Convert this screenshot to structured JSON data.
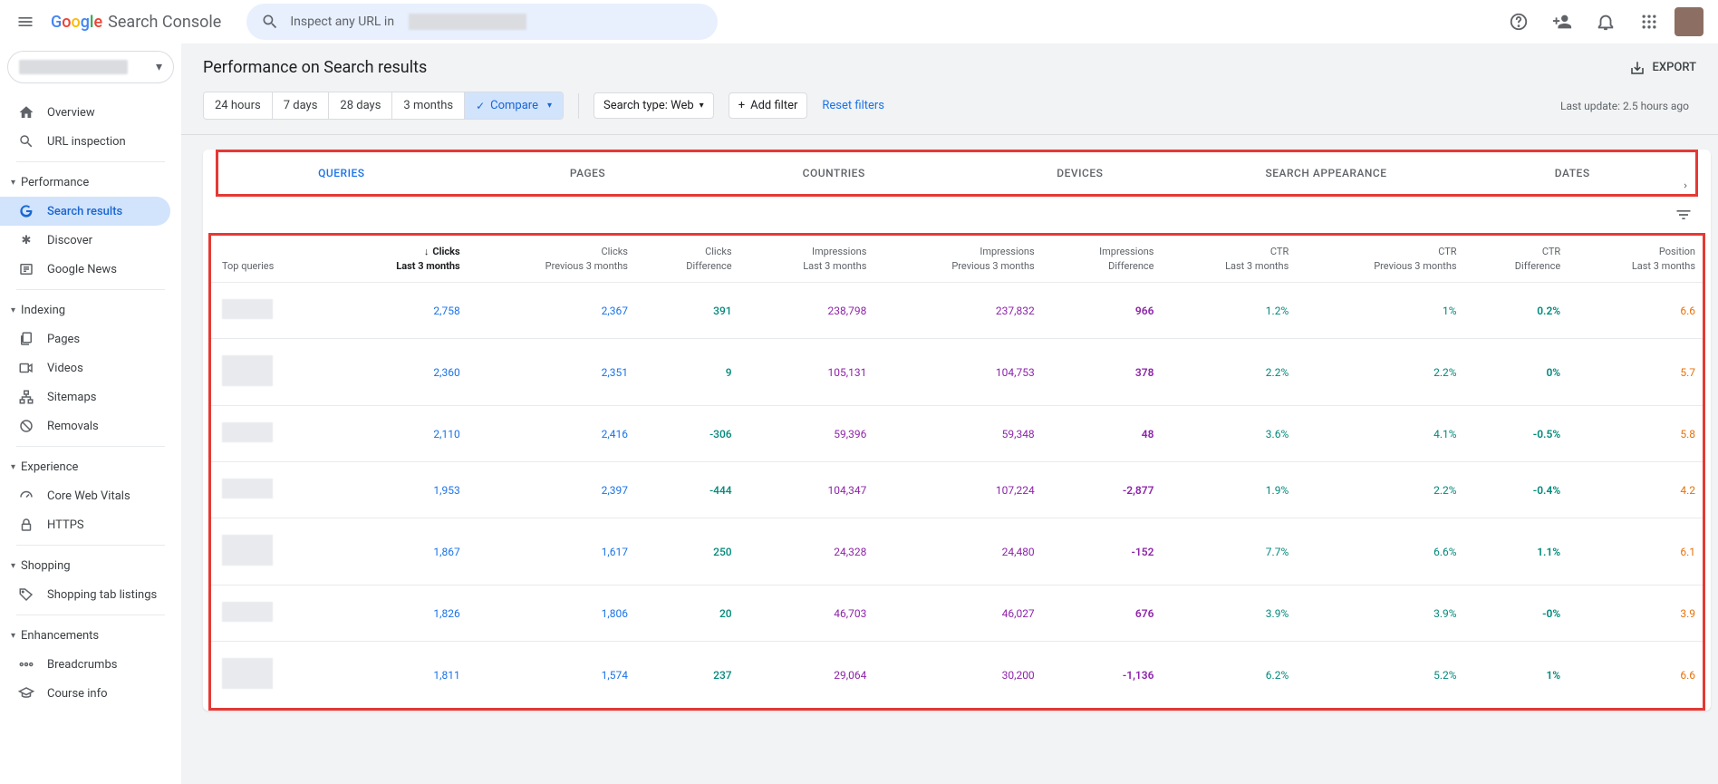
{
  "app": {
    "brand": "Google",
    "product": "Search Console",
    "search_placeholder": "Inspect any URL in"
  },
  "sidebar": {
    "overview": "Overview",
    "url_inspection": "URL inspection",
    "performance": "Performance",
    "search_results": "Search results",
    "discover": "Discover",
    "google_news": "Google News",
    "indexing": "Indexing",
    "pages": "Pages",
    "videos": "Videos",
    "sitemaps": "Sitemaps",
    "removals": "Removals",
    "experience": "Experience",
    "core_web_vitals": "Core Web Vitals",
    "https": "HTTPS",
    "shopping": "Shopping",
    "shopping_tab": "Shopping tab listings",
    "enhancements": "Enhancements",
    "breadcrumbs_item": "Breadcrumbs",
    "course_info": "Course info"
  },
  "page": {
    "title": "Performance on Search results",
    "export": "EXPORT",
    "date_ranges": [
      "24 hours",
      "7 days",
      "28 days",
      "3 months",
      "Compare"
    ],
    "search_type": "Search type: Web",
    "add_filter": "Add filter",
    "reset": "Reset filters",
    "last_update": "Last update: 2.5 hours ago"
  },
  "tabs": [
    "QUERIES",
    "PAGES",
    "COUNTRIES",
    "DEVICES",
    "SEARCH APPEARANCE",
    "DATES"
  ],
  "table": {
    "headers": {
      "query": "Top queries",
      "clicks_last": "Clicks\nLast 3 months",
      "clicks_prev": "Clicks\nPrevious 3 months",
      "clicks_diff": "Clicks\nDifference",
      "imp_last": "Impressions\nLast 3 months",
      "imp_prev": "Impressions\nPrevious 3 months",
      "imp_diff": "Impressions\nDifference",
      "ctr_last": "CTR\nLast 3 months",
      "ctr_prev": "CTR\nPrevious 3 months",
      "ctr_diff": "CTR\nDifference",
      "pos_last": "Position\nLast 3 months"
    },
    "rows": [
      {
        "clicks_last": "2,758",
        "clicks_prev": "2,367",
        "clicks_diff": "391",
        "imp_last": "238,798",
        "imp_prev": "237,832",
        "imp_diff": "966",
        "ctr_last": "1.2%",
        "ctr_prev": "1%",
        "ctr_diff": "0.2%",
        "pos_last": "6.6",
        "tall": false
      },
      {
        "clicks_last": "2,360",
        "clicks_prev": "2,351",
        "clicks_diff": "9",
        "imp_last": "105,131",
        "imp_prev": "104,753",
        "imp_diff": "378",
        "ctr_last": "2.2%",
        "ctr_prev": "2.2%",
        "ctr_diff": "0%",
        "pos_last": "5.7",
        "tall": true
      },
      {
        "clicks_last": "2,110",
        "clicks_prev": "2,416",
        "clicks_diff": "-306",
        "imp_last": "59,396",
        "imp_prev": "59,348",
        "imp_diff": "48",
        "ctr_last": "3.6%",
        "ctr_prev": "4.1%",
        "ctr_diff": "-0.5%",
        "pos_last": "5.8",
        "tall": false
      },
      {
        "clicks_last": "1,953",
        "clicks_prev": "2,397",
        "clicks_diff": "-444",
        "imp_last": "104,347",
        "imp_prev": "107,224",
        "imp_diff": "-2,877",
        "ctr_last": "1.9%",
        "ctr_prev": "2.2%",
        "ctr_diff": "-0.4%",
        "pos_last": "4.2",
        "tall": false
      },
      {
        "clicks_last": "1,867",
        "clicks_prev": "1,617",
        "clicks_diff": "250",
        "imp_last": "24,328",
        "imp_prev": "24,480",
        "imp_diff": "-152",
        "ctr_last": "7.7%",
        "ctr_prev": "6.6%",
        "ctr_diff": "1.1%",
        "pos_last": "6.1",
        "tall": true
      },
      {
        "clicks_last": "1,826",
        "clicks_prev": "1,806",
        "clicks_diff": "20",
        "imp_last": "46,703",
        "imp_prev": "46,027",
        "imp_diff": "676",
        "ctr_last": "3.9%",
        "ctr_prev": "3.9%",
        "ctr_diff": "-0%",
        "pos_last": "3.9",
        "tall": false
      },
      {
        "clicks_last": "1,811",
        "clicks_prev": "1,574",
        "clicks_diff": "237",
        "imp_last": "29,064",
        "imp_prev": "30,200",
        "imp_diff": "-1,136",
        "ctr_last": "6.2%",
        "ctr_prev": "5.2%",
        "ctr_diff": "1%",
        "pos_last": "6.6",
        "tall": true
      }
    ]
  }
}
